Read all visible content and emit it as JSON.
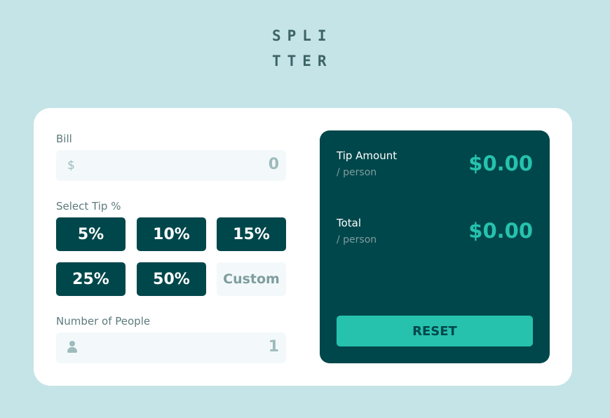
{
  "logo": {
    "line1": "SPLI",
    "line2": "TTER"
  },
  "bill": {
    "label": "Bill",
    "currency_icon": "$",
    "value": "0"
  },
  "tip": {
    "label": "Select Tip %",
    "options": [
      "5%",
      "10%",
      "15%",
      "25%",
      "50%"
    ],
    "custom_placeholder": "Custom"
  },
  "people": {
    "label": "Number of People",
    "value": "1"
  },
  "results": {
    "tip_label": "Tip Amount",
    "tip_sub": "/ person",
    "tip_value": "$0.00",
    "total_label": "Total",
    "total_sub": "/ person",
    "total_value": "$0.00",
    "reset_label": "RESET"
  },
  "colors": {
    "background": "#c5e4e7",
    "dark_cyan": "#00474b",
    "accent": "#26c2ad"
  }
}
